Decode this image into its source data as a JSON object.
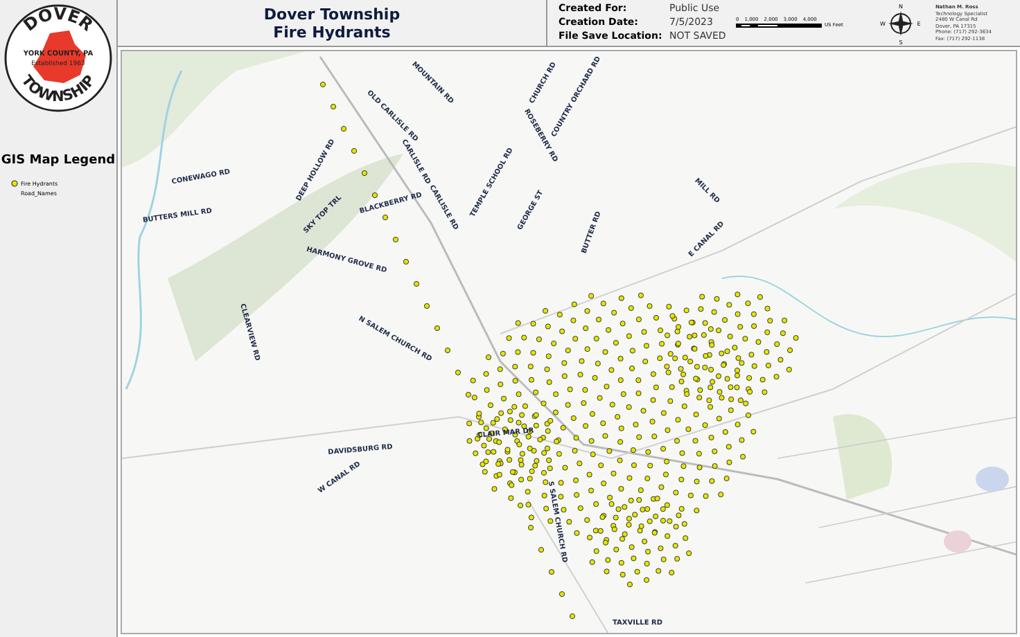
{
  "logo": {
    "top": "DOVER",
    "county": "YORK COUNTY, PA",
    "established": "Established 1963",
    "bottom": "TOWNSHIP"
  },
  "legend": {
    "title": "GIS Map Legend",
    "items": [
      {
        "kind": "point",
        "label": "Fire Hydrants",
        "color": "#e6e600"
      },
      {
        "kind": "text",
        "label": "Road_Names"
      }
    ]
  },
  "title": [
    "Dover Township",
    "Fire Hydrants"
  ],
  "info": [
    {
      "label": "Created For:",
      "value": "Public Use"
    },
    {
      "label": "Creation Date:",
      "value": "7/5/2023"
    },
    {
      "label": "File Save Location:",
      "value": "NOT SAVED"
    }
  ],
  "scale_bar": {
    "ticks": [
      "0",
      "1,000",
      "2,000",
      "3,000",
      "4,000"
    ],
    "unit": "US Feet"
  },
  "compass": {
    "n": "N",
    "s": "S",
    "e": "E",
    "w": "W"
  },
  "contact": [
    "Nathan M. Ross",
    "Technology Specialist",
    "2480 W Canal Rd",
    "Dover, PA 17315",
    "Phone: (717) 292-3634",
    "Fax: (717) 292-1138"
  ],
  "road_labels": [
    "MOUNTAIN RD",
    "OLD CARLISLE RD",
    "CARLISLE RD",
    "CARLISLE RD",
    "CHURCH RD",
    "COUNTRY ORCHARD RD",
    "ROSEBERRY RD",
    "TEMPLE SCHOOL RD",
    "GEORGE ST",
    "BUTTER RD",
    "MILL RD",
    "E CANAL RD",
    "BLACKBERRY RD",
    "HARMONY GROVE RD",
    "SKY TOP TRL",
    "DEEP HOLLOW RD",
    "CONEWAGO RD",
    "BUTTERS MILL RD",
    "CLEARVIEW RD",
    "N SALEM CHURCH RD",
    "DAVIDSBURG RD",
    "CLAIR MAR DR",
    "W CANAL RD",
    "S SALEM CHURCH RD",
    "TAXVILLE RD"
  ]
}
